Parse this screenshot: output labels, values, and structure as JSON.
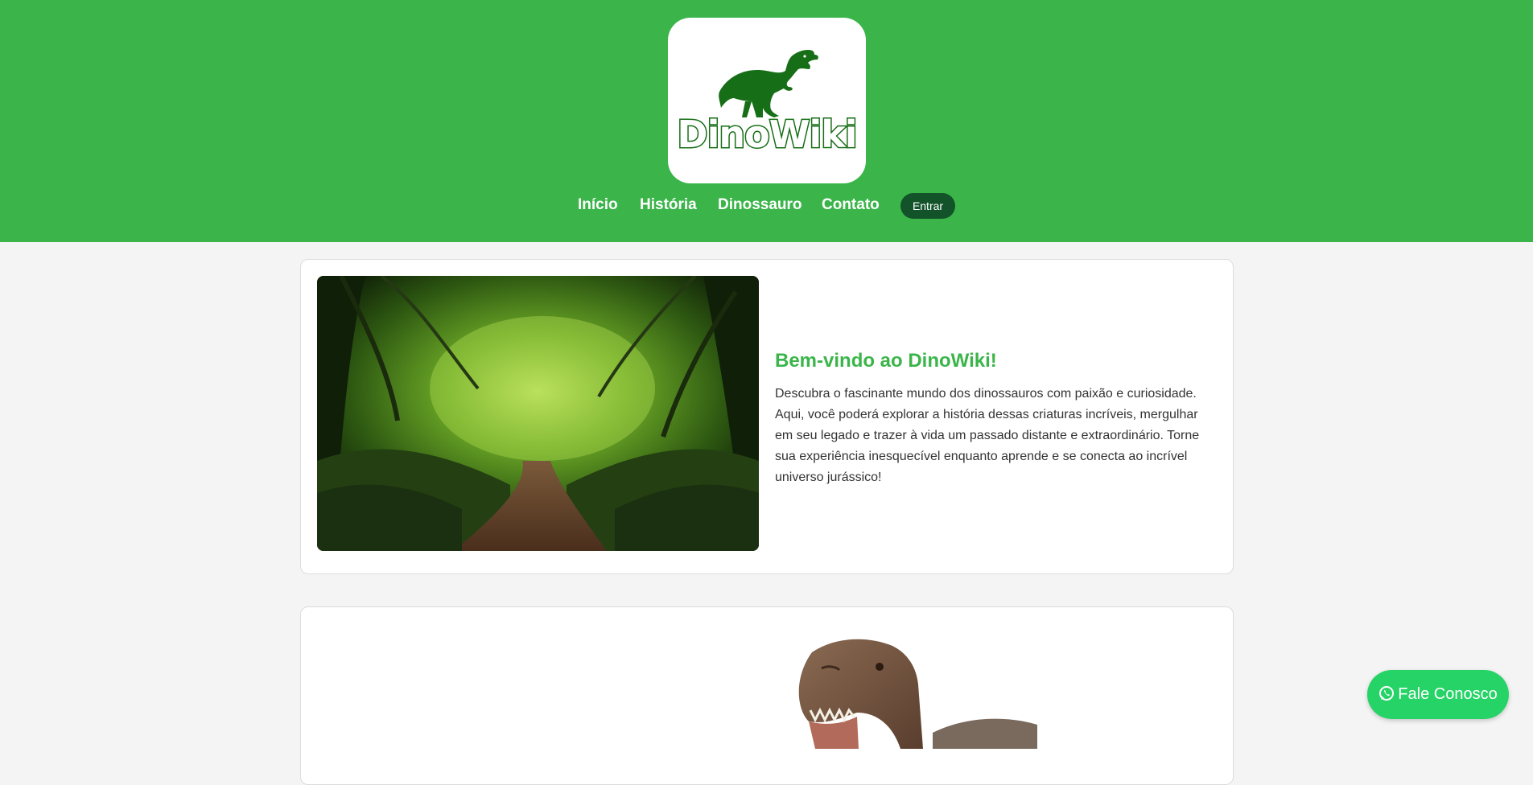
{
  "header": {
    "logo_text": "DinoWiki",
    "background": "#3bb54a"
  },
  "nav": {
    "items": [
      {
        "label": "Início"
      },
      {
        "label": "História"
      },
      {
        "label": "Dinossauro"
      },
      {
        "label": "Contato"
      }
    ],
    "login_label": "Entrar"
  },
  "welcome": {
    "title": "Bem-vindo ao DinoWiki!",
    "text": "Descubra o fascinante mundo dos dinossauros com paixão e curiosidade. Aqui, você poderá explorar a história dessas criaturas incríveis, mergulhar em seu legado e trazer à vida um passado distante e extraordinário. Torne sua experiência inesquecível enquanto aprende e se conecta ao incrível universo jurássico!",
    "image_icon": "forest-path-image"
  },
  "second_card": {
    "image_icon": "t-rex-image"
  },
  "floating": {
    "whatsapp_label": "Fale Conosco",
    "icon": "whatsapp-icon",
    "color": "#25d366"
  },
  "colors": {
    "accent": "#3bb54a",
    "dark_green": "#12532a",
    "logo_green": "#166e16"
  }
}
